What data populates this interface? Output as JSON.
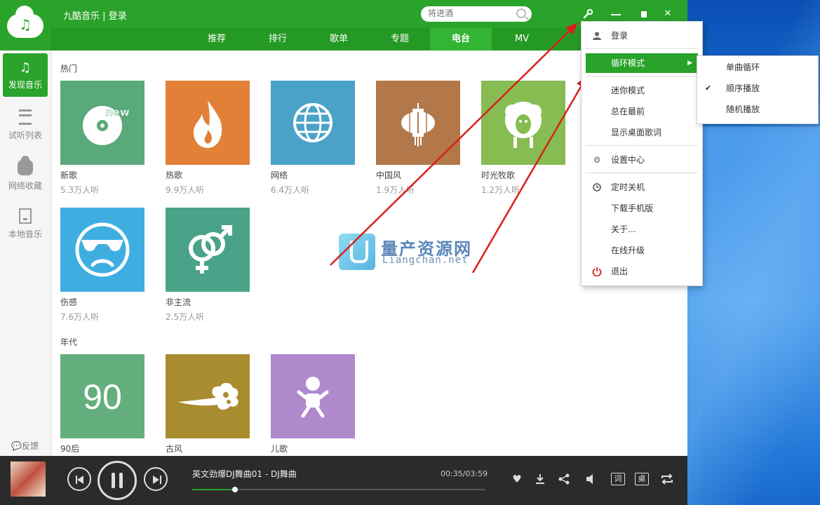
{
  "window": {
    "title": "九酷音乐 | 登录"
  },
  "search": {
    "placeholder": "将进酒"
  },
  "window_controls": {
    "close": "✕"
  },
  "tabs": [
    {
      "label": "推荐",
      "active": false
    },
    {
      "label": "排行",
      "active": false
    },
    {
      "label": "歌单",
      "active": false
    },
    {
      "label": "专题",
      "active": false
    },
    {
      "label": "电台",
      "active": true
    },
    {
      "label": "MV",
      "active": false
    }
  ],
  "sidebar": {
    "items": [
      {
        "label": "发现音乐",
        "icon": "music-note-icon",
        "active": true
      },
      {
        "label": "试听列表",
        "icon": "list-icon",
        "active": false
      },
      {
        "label": "网络收藏",
        "icon": "cloud-icon",
        "active": false
      },
      {
        "label": "本地音乐",
        "icon": "monitor-icon",
        "active": false
      }
    ],
    "feedback": "反馈"
  },
  "sections": {
    "hot": {
      "title": "热门"
    },
    "era": {
      "title": "年代"
    }
  },
  "cards": {
    "hot": [
      {
        "name": "新歌",
        "listeners": "5.3万人听",
        "color": "#5aa97a",
        "icon": "disc-new-icon",
        "badge": "new"
      },
      {
        "name": "热歌",
        "listeners": "9.9万人听",
        "color": "#e28038",
        "icon": "flame-icon"
      },
      {
        "name": "网络",
        "listeners": "6.4万人听",
        "color": "#4aa2c8",
        "icon": "globe-icon"
      },
      {
        "name": "中国风",
        "listeners": "1.9万人听",
        "color": "#b2784a",
        "icon": "lantern-icon"
      },
      {
        "name": "时光牧歌",
        "listeners": "1.2万人听",
        "color": "#86bc52",
        "icon": "sheep-icon"
      },
      {
        "name": "伤感",
        "listeners": "7.6万人听",
        "color": "#3eaee0",
        "icon": "sad-face-icon"
      },
      {
        "name": "非主流",
        "listeners": "2.5万人听",
        "color": "#4aa288",
        "icon": "gender-icon"
      }
    ],
    "era": [
      {
        "name": "90后",
        "listeners": "",
        "color": "#64ae7e",
        "icon": "number-90-icon",
        "text": "90"
      },
      {
        "name": "古风",
        "listeners": "",
        "color": "#aa8c30",
        "icon": "cloud-pattern-icon"
      },
      {
        "name": "儿歌",
        "listeners": "",
        "color": "#b088cc",
        "icon": "baby-icon"
      }
    ]
  },
  "watermark": {
    "title": "量产资源网",
    "subtitle": "Liangchan.net"
  },
  "player": {
    "song": "英文劲爆DJ舞曲01 - DJ舞曲",
    "time": "00:35/03:59",
    "progress": 0.146,
    "lyrics_btn": "词",
    "desktop_btn": "桌"
  },
  "menu": {
    "items": [
      {
        "label": "登录",
        "icon": "user-icon"
      },
      {
        "label": "循环模式",
        "icon": "",
        "highlighted": true,
        "submenu": true
      },
      {
        "label": "迷你模式",
        "icon": ""
      },
      {
        "label": "总在最前",
        "icon": ""
      },
      {
        "label": "显示桌面歌词",
        "icon": ""
      },
      {
        "label": "设置中心",
        "icon": "gear-icon"
      },
      {
        "label": "定时关机",
        "icon": "clock-icon"
      },
      {
        "label": "下载手机版",
        "icon": ""
      },
      {
        "label": "关于...",
        "icon": ""
      },
      {
        "label": "在线升级",
        "icon": ""
      },
      {
        "label": "退出",
        "icon": "power-icon"
      }
    ],
    "submenu": [
      {
        "label": "单曲循环",
        "checked": false
      },
      {
        "label": "顺序播放",
        "checked": true
      },
      {
        "label": "随机播放",
        "checked": false
      }
    ]
  },
  "colors": {
    "brand": "#2aa32a",
    "annotation_arrow": "#d8201c"
  }
}
